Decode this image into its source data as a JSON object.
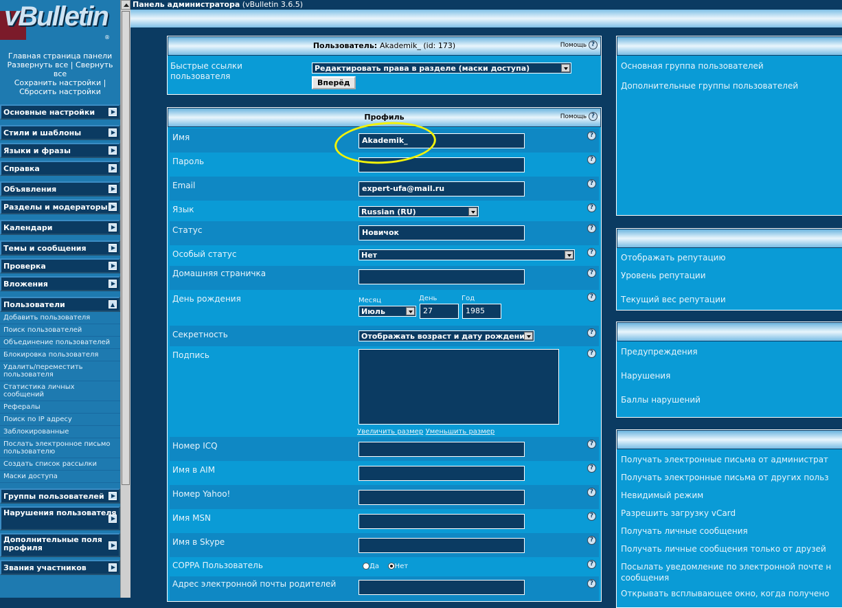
{
  "nav": {
    "logo_text": "vBulletin",
    "logo_reg": "®",
    "links": [
      "Главная страница панели",
      "Развернуть все | Свернуть все",
      "Сохранить настройки |",
      "Сбросить настройки"
    ],
    "groups": [
      {
        "label": "Основные настройки"
      },
      {
        "label": "Стили и шаблоны"
      },
      {
        "label": "Языки и фразы"
      },
      {
        "label": "Справка"
      },
      {
        "label": "Объявления"
      },
      {
        "label": "Разделы и модераторы"
      },
      {
        "label": "Календари"
      },
      {
        "label": "Темы и сообщения"
      },
      {
        "label": "Проверка"
      },
      {
        "label": "Вложения"
      },
      {
        "label": "Пользователи"
      },
      {
        "label": "Группы пользователей"
      },
      {
        "label": "Нарушения пользователя"
      },
      {
        "label": "Дополнительные поля профиля"
      },
      {
        "label": "Звания участников"
      }
    ],
    "users_sub": [
      "Добавить пользователя",
      "Поиск пользователей",
      "Объединение пользователей",
      "Блокировка пользователя",
      "Удалить/переместить пользователя",
      "Статистика личных сообщений",
      "Рефералы",
      "Поиск по IP адресу",
      "Заблокированные",
      "Послать электронное письмо пользователю",
      "Создать список рассылки",
      "Маски доступа"
    ]
  },
  "topbar": {
    "title": "Панель администратора",
    "version": "(vBulletin 3.6.5)"
  },
  "user_panel": {
    "title_prefix": "Пользователь:",
    "title_value": "Akademik_ (id: 173)",
    "help": "Помощь",
    "quick_links_label": "Быстрые ссылки пользователя",
    "quick_links_value": "Редактировать права в разделе (маски доступа)",
    "go_button": "Вперёд"
  },
  "profile": {
    "title": "Профиль",
    "help": "Помощь",
    "name_label": "Имя",
    "name_value": "Akademik_",
    "password_label": "Пароль",
    "email_label": "Email",
    "email_value": "expert-ufa@mail.ru",
    "lang_label": "Язык",
    "lang_value": "Russian (RU)",
    "status_label": "Статус",
    "status_value": "Новичок",
    "special_label": "Особый статус",
    "special_value": "Нет",
    "homepage_label": "Домашняя страничка",
    "bday_label": "День рождения",
    "month_label": "Месяц",
    "month_value": "Июль",
    "day_label": "День",
    "day_value": "27",
    "year_label": "Год",
    "year_value": "1985",
    "privacy_label": "Секретность",
    "privacy_value": "Отображать возраст и дату рождения",
    "signature_label": "Подпись",
    "enlarge": "Увеличить размер",
    "shrink": "Уменьшить размер",
    "icq_label": "Номер ICQ",
    "aim_label": "Имя в AIM",
    "yahoo_label": "Номер Yahoo!",
    "msn_label": "Имя MSN",
    "skype_label": "Имя в Skype",
    "coppa_label": "COPPA Пользователь",
    "coppa_yes": "Да",
    "coppa_no": "Нет",
    "parent_email_label": "Адрес электронной почты родителей"
  },
  "right": {
    "groups": [
      "Основная группа пользователей",
      "Дополнительные группы пользователей"
    ],
    "reputation": [
      "Отображать репутацию",
      "Уровень репутации",
      "Текущий вес репутации"
    ],
    "infractions": [
      "Предупреждения",
      "Нарушения",
      "Баллы нарушений"
    ],
    "options": [
      "Получать электронные письма от администрат",
      "Получать электронные письма от других польз",
      "Невидимый режим",
      "Разрешить загрузку vCard",
      "Получать личные сообщения",
      "Получать личные сообщения только от друзей",
      "Посылать уведомление по электронной почте н",
      "сообщения",
      "Открывать всплывающее окно, когда получено"
    ]
  }
}
